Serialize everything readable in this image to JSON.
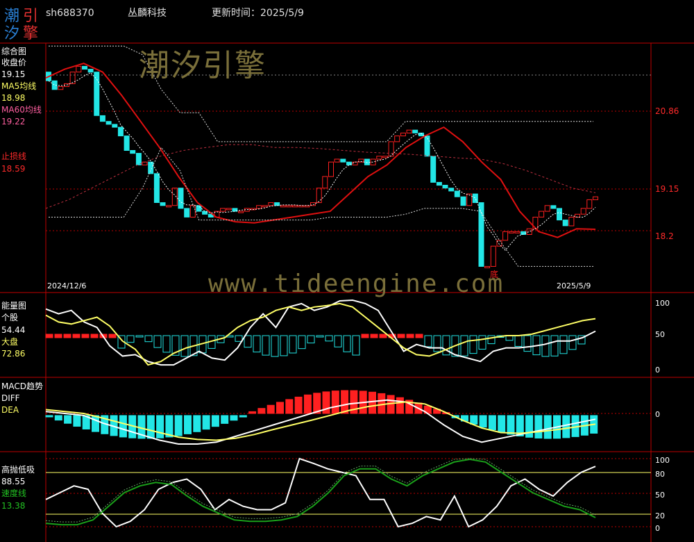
{
  "header": {
    "logo_chars": [
      "潮",
      "引",
      "汐",
      "擎"
    ],
    "code": "sh688370",
    "name": "丛麟科技",
    "update_label": "更新时间：2025/5/9"
  },
  "watermarks": {
    "cn": "潮汐引擎",
    "url": "www.tideengine.com"
  },
  "panels": {
    "main": {
      "title": "综合图",
      "items": [
        {
          "label": "收盘价",
          "value": "19.15",
          "color": "#ffffff"
        },
        {
          "label": "MA5均线",
          "value": "18.98",
          "color": "#ffff66"
        },
        {
          "label": "MA60均线",
          "value": "19.22",
          "color": "#ff5fa0"
        },
        {
          "label": "止损线",
          "value": "18.59",
          "color": "#ff2a2a"
        }
      ],
      "date_start": "2024/12/6",
      "date_end": "2025/5/9",
      "bottom_marker": "底",
      "axis_labels": [
        "20.86",
        "19.15",
        "18.2"
      ]
    },
    "energy": {
      "title": "能量图",
      "items": [
        {
          "label": "个股",
          "value": "54.44",
          "color": "#ffffff"
        },
        {
          "label": "大盘",
          "value": "72.86",
          "color": "#ffff66"
        }
      ],
      "axis_labels": [
        "100",
        "50",
        "0"
      ]
    },
    "macd": {
      "title": "MACD趋势",
      "items": [
        {
          "label": "DIFF",
          "value": "",
          "color": "#ffffff"
        },
        {
          "label": "DEA",
          "value": "",
          "color": "#ffff66"
        }
      ],
      "axis_labels": [
        "0"
      ]
    },
    "hl": {
      "title": "高抛低吸",
      "items": [
        {
          "label": "",
          "value": "88.55",
          "color": "#ffffff"
        },
        {
          "label": "速度线",
          "value": "13.38",
          "color": "#22c122"
        }
      ],
      "axis_labels": [
        "100",
        "80",
        "50",
        "20",
        "0"
      ]
    }
  },
  "colors": {
    "up": "#ff2020",
    "down": "#22e6e6",
    "axis": "#c00000",
    "ma5": "#ffffff",
    "ma60": "#c03040",
    "stop": "#e01010",
    "speed": "#1aa01a"
  },
  "chart_data": [
    {
      "type": "candlestick",
      "title": "综合图",
      "x_start": "2024/12/6",
      "x_end": "2025/5/9",
      "ylim": [
        17.5,
        21.8
      ],
      "series": [
        {
          "name": "收盘价",
          "values": [
            21.15,
            21.0,
            21.05,
            21.1,
            21.3,
            21.4,
            21.35,
            21.3,
            20.55,
            20.45,
            20.4,
            20.35,
            20.2,
            19.95,
            19.9,
            19.7,
            19.75,
            19.55,
            19.05,
            19.0,
            19.0,
            19.3,
            18.95,
            18.8,
            19.0,
            18.9,
            18.85,
            18.8,
            18.9,
            18.95,
            18.95,
            18.9,
            18.9,
            18.95,
            18.95,
            19.0,
            19.0,
            19.05,
            19.0,
            19.0,
            19.0,
            19.0,
            19.0,
            19.0,
            19.05,
            19.3,
            19.5,
            19.75,
            19.8,
            19.75,
            19.7,
            19.75,
            19.8,
            19.7,
            19.8,
            19.85,
            19.85,
            20.1,
            20.2,
            20.25,
            20.3,
            20.25,
            20.2,
            19.85,
            19.4,
            19.35,
            19.3,
            19.25,
            19.15,
            19.0,
            19.2,
            19.05,
            17.95,
            17.95,
            18.3,
            18.4,
            18.55,
            18.55,
            18.55,
            18.5,
            18.6,
            18.8,
            18.9,
            19.0,
            18.95,
            18.75,
            18.65,
            18.8,
            18.85,
            18.95,
            19.1,
            19.15
          ]
        },
        {
          "name": "MA60均线",
          "values": [
            18.95,
            19.1,
            19.3,
            19.5,
            19.7,
            19.85,
            19.95,
            20.0,
            20.05,
            20.05,
            20.0,
            20.0,
            19.98,
            19.95,
            19.92,
            19.9,
            19.88,
            19.85,
            19.82,
            19.8,
            19.72,
            19.6,
            19.45,
            19.3,
            19.22
          ]
        },
        {
          "name": "止损线",
          "values": [
            21.2,
            21.35,
            21.45,
            21.3,
            20.9,
            20.45,
            20.0,
            19.5,
            19.05,
            18.8,
            18.72,
            18.7,
            18.75,
            18.8,
            18.85,
            18.9,
            19.2,
            19.5,
            19.7,
            20.0,
            20.2,
            20.35,
            20.1,
            19.75,
            19.45,
            18.9,
            18.55,
            18.45,
            18.6,
            18.59
          ]
        }
      ]
    },
    {
      "type": "line",
      "title": "能量图",
      "ylim": [
        0,
        100
      ],
      "series": [
        {
          "name": "个股",
          "values": [
            87,
            80,
            85,
            68,
            60,
            33,
            18,
            20,
            10,
            5,
            5,
            15,
            25,
            15,
            12,
            30,
            60,
            80,
            60,
            90,
            95,
            85,
            90,
            99,
            100,
            95,
            85,
            55,
            25,
            35,
            30,
            30,
            20,
            15,
            10,
            25,
            30,
            30,
            32,
            35,
            40,
            40,
            45,
            54.44
          ]
        },
        {
          "name": "大盘",
          "values": [
            78,
            68,
            65,
            70,
            75,
            62,
            40,
            28,
            5,
            10,
            22,
            30,
            35,
            40,
            45,
            60,
            70,
            75,
            85,
            90,
            85,
            90,
            92,
            95,
            90,
            75,
            60,
            45,
            30,
            20,
            18,
            25,
            33,
            40,
            42,
            45,
            48,
            48,
            50,
            55,
            60,
            65,
            70,
            72.86
          ]
        }
      ]
    },
    {
      "type": "bar",
      "title": "MACD趋势",
      "series": [
        {
          "name": "DIFF",
          "values": [
            0.05,
            0.0,
            -0.05,
            -0.25,
            -0.4,
            -0.55,
            -0.7,
            -0.8,
            -0.8,
            -0.75,
            -0.6,
            -0.45,
            -0.3,
            -0.15,
            0.0,
            0.15,
            0.25,
            0.3,
            0.35,
            0.3,
            0.05,
            -0.3,
            -0.6,
            -0.75,
            -0.65,
            -0.55,
            -0.45,
            -0.35,
            -0.25,
            -0.15
          ]
        },
        {
          "name": "DEA",
          "values": [
            0.1,
            0.05,
            0.0,
            -0.12,
            -0.25,
            -0.38,
            -0.5,
            -0.62,
            -0.68,
            -0.7,
            -0.65,
            -0.55,
            -0.42,
            -0.3,
            -0.18,
            -0.05,
            0.08,
            0.18,
            0.25,
            0.3,
            0.25,
            0.05,
            -0.18,
            -0.38,
            -0.5,
            -0.52,
            -0.48,
            -0.42,
            -0.35,
            -0.28
          ]
        }
      ]
    },
    {
      "type": "line",
      "title": "高抛低吸",
      "ylim": [
        0,
        100
      ],
      "series": [
        {
          "name": "高抛低吸",
          "values": [
            40,
            50,
            60,
            55,
            20,
            0,
            8,
            25,
            55,
            65,
            70,
            55,
            25,
            40,
            30,
            25,
            25,
            35,
            100,
            93,
            85,
            80,
            75,
            40,
            40,
            0,
            5,
            15,
            10,
            45,
            0,
            10,
            30,
            60,
            70,
            55,
            45,
            65,
            80,
            88.55
          ]
        },
        {
          "name": "速度线",
          "values": [
            5,
            3,
            3,
            10,
            30,
            50,
            60,
            65,
            62,
            45,
            30,
            20,
            10,
            8,
            8,
            10,
            15,
            30,
            50,
            75,
            85,
            85,
            70,
            60,
            75,
            85,
            95,
            99,
            95,
            80,
            65,
            50,
            40,
            30,
            25,
            13.38
          ]
        }
      ]
    }
  ]
}
